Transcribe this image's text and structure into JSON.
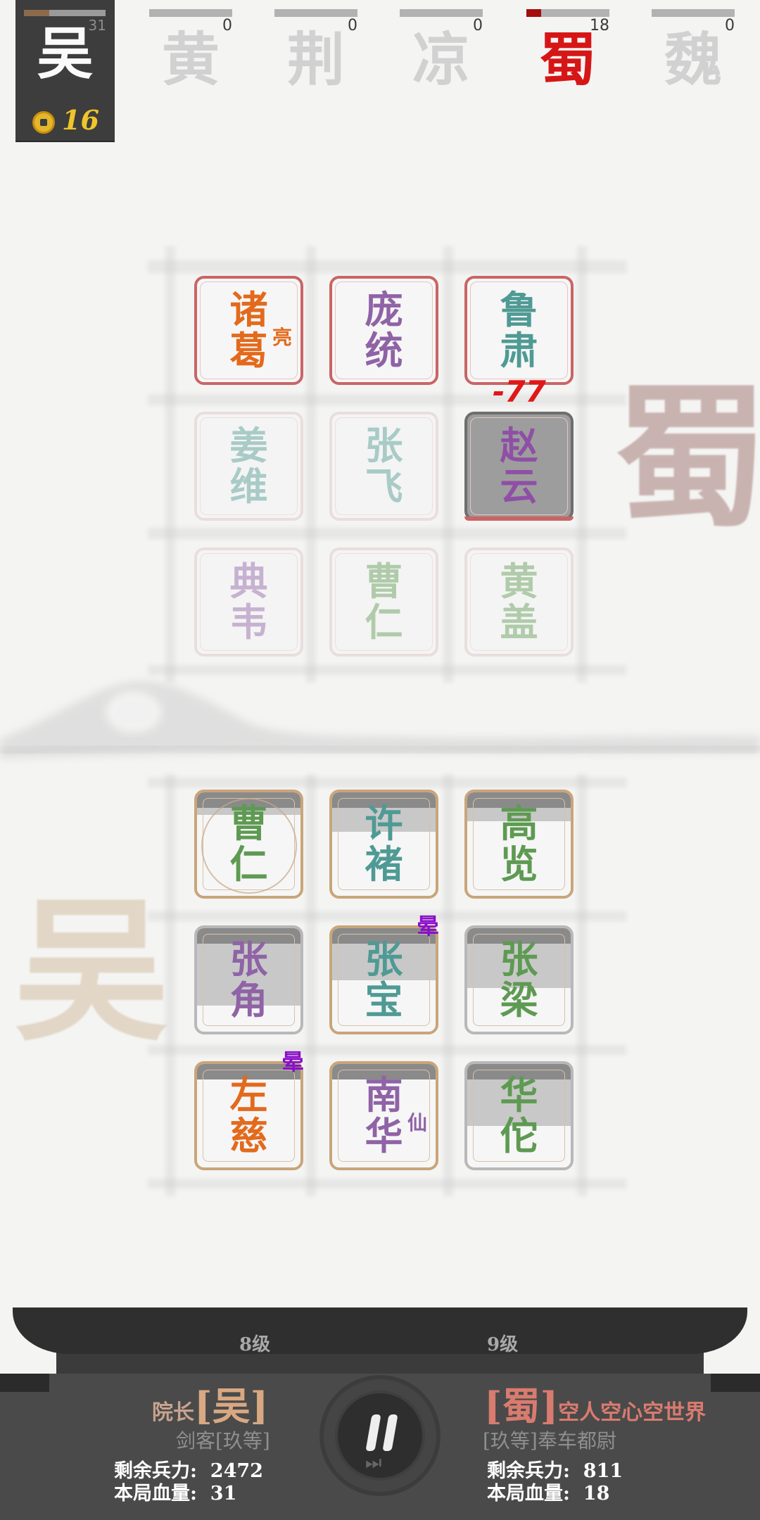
{
  "player": {
    "faction": "吴",
    "hp": "31",
    "hp_fraction": 0.31,
    "gold": "16"
  },
  "enemies": [
    {
      "faction": "黄",
      "hp": "0",
      "hp_fraction": 0,
      "active": false
    },
    {
      "faction": "荆",
      "hp": "0",
      "hp_fraction": 0,
      "active": false
    },
    {
      "faction": "凉",
      "hp": "0",
      "hp_fraction": 0,
      "active": false
    },
    {
      "faction": "蜀",
      "hp": "18",
      "hp_fraction": 0.18,
      "active": true
    },
    {
      "faction": "魏",
      "hp": "0",
      "hp_fraction": 0,
      "active": false
    }
  ],
  "board": {
    "enemy_mark": "蜀",
    "player_mark": "吴",
    "damage_text": "-77",
    "enemy_units": [
      {
        "line1": "诸",
        "line2": "葛",
        "sub": "亮",
        "color": "#e36a1c",
        "state": "normal"
      },
      {
        "line1": "庞",
        "line2": "统",
        "sub": "",
        "color": "#8f63a6",
        "state": "normal"
      },
      {
        "line1": "鲁",
        "line2": "肃",
        "sub": "",
        "color": "#4f9a94",
        "state": "normal"
      },
      {
        "line1": "姜",
        "line2": "维",
        "sub": "",
        "color": "#4f9a94",
        "state": "ghost"
      },
      {
        "line1": "张",
        "line2": "飞",
        "sub": "",
        "color": "#4f9a94",
        "state": "ghost"
      },
      {
        "line1": "赵",
        "line2": "云",
        "sub": "",
        "color": "#8f4fa6",
        "state": "hit"
      },
      {
        "line1": "典",
        "line2": "韦",
        "sub": "",
        "color": "#8f63a6",
        "state": "ghost"
      },
      {
        "line1": "曹",
        "line2": "仁",
        "sub": "",
        "color": "#5e9a52",
        "state": "ghost"
      },
      {
        "line1": "黄",
        "line2": "盖",
        "sub": "",
        "color": "#5e9a52",
        "state": "ghost"
      }
    ],
    "player_units": [
      {
        "line1": "曹",
        "line2": "仁",
        "sub": "",
        "color": "#5e9a52",
        "hp_fraction": 0.78,
        "tag": ""
      },
      {
        "line1": "许",
        "line2": "褚",
        "sub": "",
        "color": "#4f9a94",
        "hp_fraction": 0.62,
        "tag": ""
      },
      {
        "line1": "高",
        "line2": "览",
        "sub": "",
        "color": "#5e9a52",
        "hp_fraction": 0.72,
        "tag": ""
      },
      {
        "line1": "张",
        "line2": "角",
        "sub": "",
        "color": "#8f63a6",
        "hp_fraction": 0.25,
        "tag": ""
      },
      {
        "line1": "张",
        "line2": "宝",
        "sub": "",
        "color": "#4f9a94",
        "hp_fraction": 0.5,
        "tag": "晕"
      },
      {
        "line1": "张",
        "line2": "梁",
        "sub": "",
        "color": "#5e9a52",
        "hp_fraction": 0.42,
        "tag": ""
      },
      {
        "line1": "左",
        "line2": "慈",
        "sub": "",
        "color": "#e36a1c",
        "hp_fraction": 0.88,
        "tag": "晕"
      },
      {
        "line1": "南",
        "line2": "华",
        "sub": "仙",
        "color": "#8f63a6",
        "hp_fraction": 0.85,
        "tag": ""
      },
      {
        "line1": "华",
        "line2": "佗",
        "sub": "",
        "color": "#5e9a52",
        "hp_fraction": 0.4,
        "tag": ""
      }
    ]
  },
  "bottom": {
    "left_level": "8级",
    "right_level": "9级",
    "left_title": "院长",
    "left_faction": "吴",
    "left_rank": "剑客[玖等]",
    "left_troops_label": "剩余兵力:",
    "left_troops": "2472",
    "left_hp_label": "本局血量:",
    "left_hp": "31",
    "right_faction": "蜀",
    "right_title": "空人空心空世界",
    "right_rank": "[玖等]奉车都尉",
    "right_troops_label": "剩余兵力:",
    "right_troops": "811",
    "right_hp_label": "本局血量:",
    "right_hp": "18",
    "pause_icon": "pause-icon",
    "ff_icon": "fast-forward-icon",
    "ff_glyph": "⏭"
  },
  "colors": {
    "bracket_left": "#d8a882",
    "bracket_right": "#d97b6f",
    "right_title": "#d97b6f"
  }
}
